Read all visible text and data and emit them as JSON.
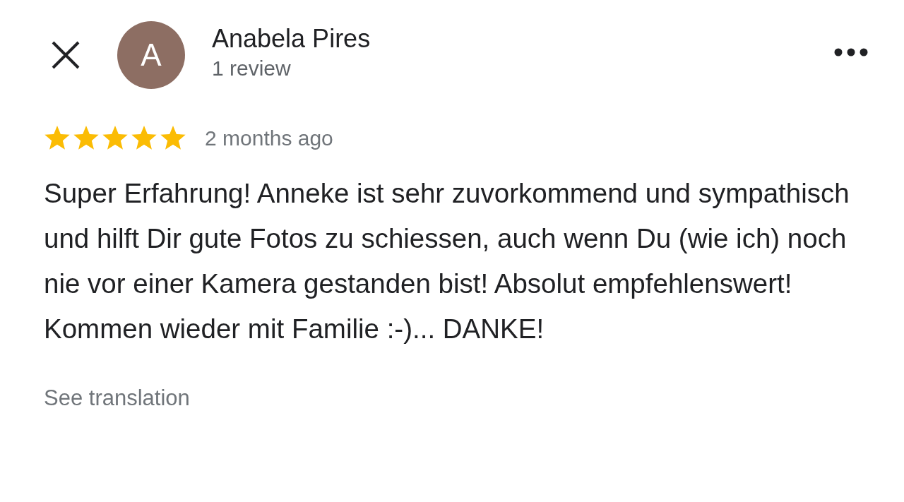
{
  "reviewer": {
    "initial": "A",
    "name": "Anabela Pires",
    "review_count": "1 review"
  },
  "review": {
    "stars": 5,
    "time": "2 months ago",
    "text": "Super Erfahrung! Anneke ist sehr zuvorkommend und sympathisch und hilft Dir gute Fotos zu schiessen, auch wenn Du (wie ich) noch nie vor einer Kamera gestanden bist! Absolut empfehlenswert! Kommen wieder mit Familie :-)... DANKE!"
  },
  "translate_link": "See translation"
}
